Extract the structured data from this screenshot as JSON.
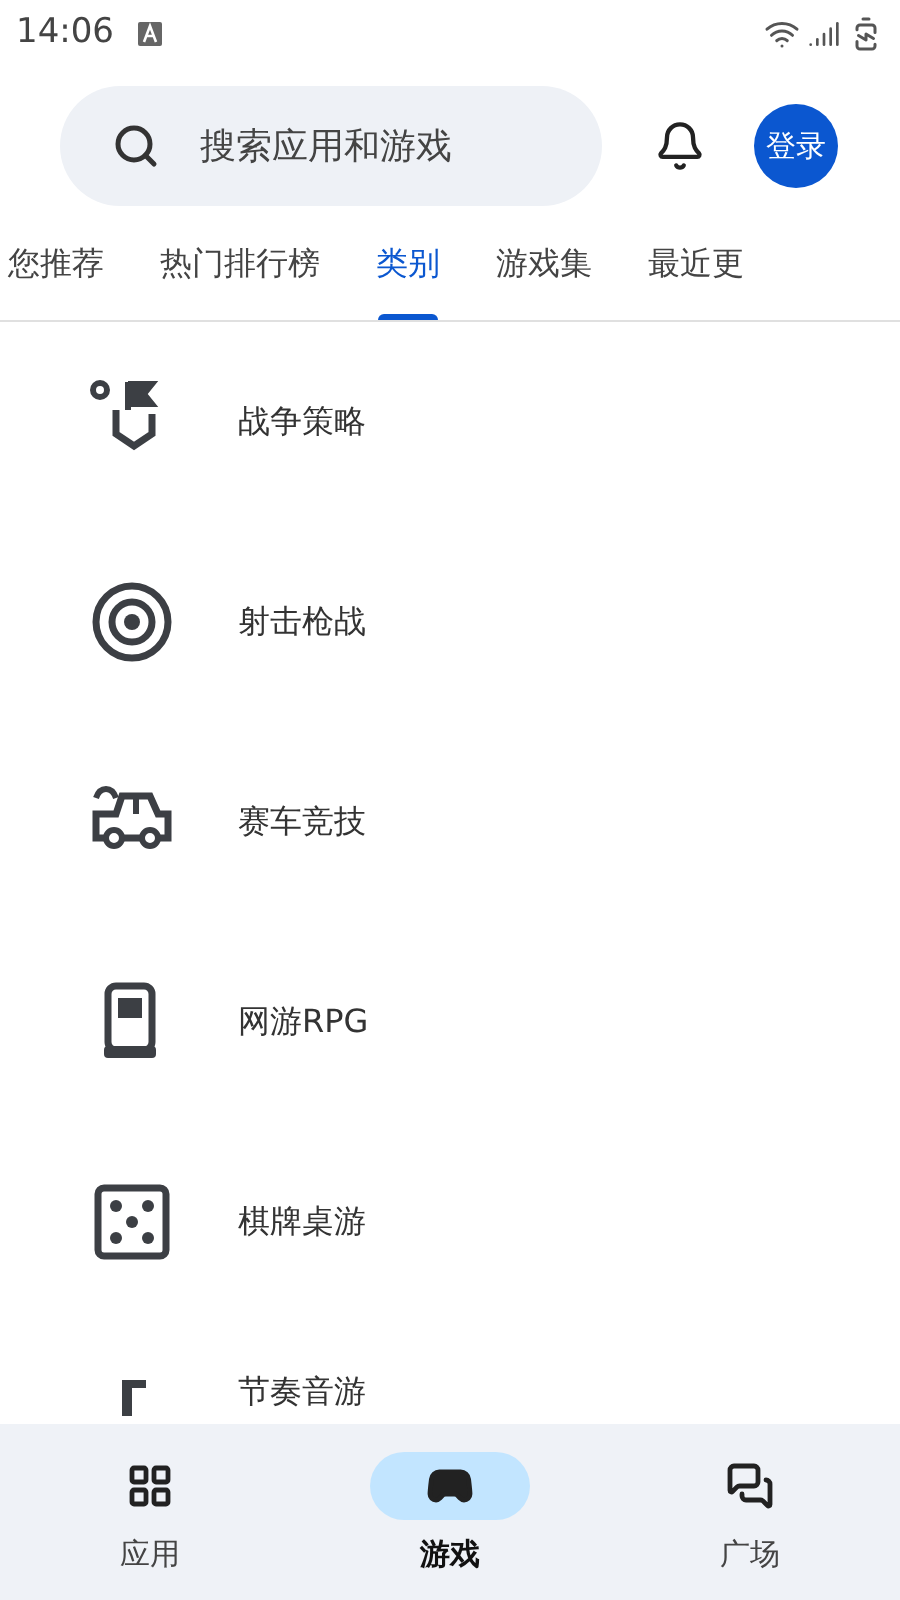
{
  "status_bar": {
    "time": "14:06"
  },
  "search": {
    "placeholder": "搜索应用和游戏"
  },
  "login_button": "登录",
  "tabs": [
    {
      "label": "您推荐",
      "selected": false
    },
    {
      "label": "热门排行榜",
      "selected": false
    },
    {
      "label": "类别",
      "selected": true
    },
    {
      "label": "游戏集",
      "selected": false
    },
    {
      "label": "最近更",
      "selected": false
    }
  ],
  "categories": [
    {
      "label": "战争策略"
    },
    {
      "label": "射击枪战"
    },
    {
      "label": "赛车竞技"
    },
    {
      "label": "网游RPG"
    },
    {
      "label": "棋牌桌游"
    },
    {
      "label": "节奏音游"
    }
  ],
  "bottom_nav": [
    {
      "label": "应用",
      "selected": false
    },
    {
      "label": "游戏",
      "selected": true
    },
    {
      "label": "广场",
      "selected": false
    }
  ]
}
